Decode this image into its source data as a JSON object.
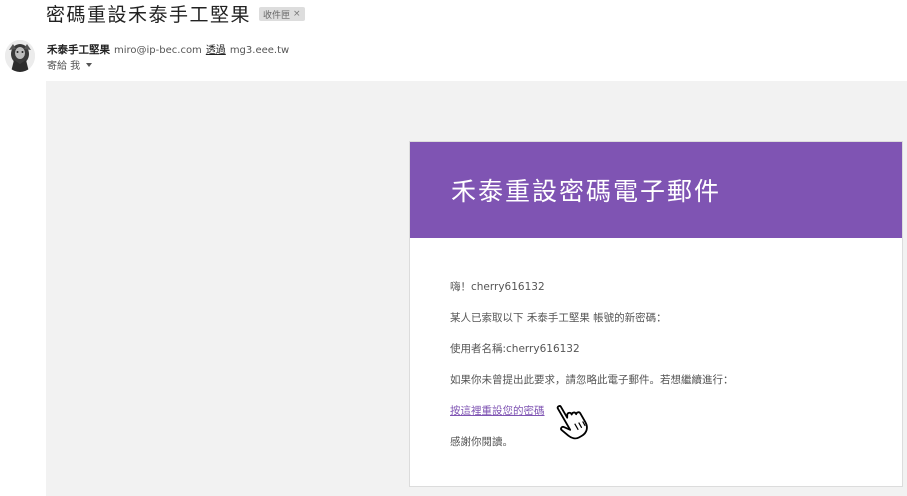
{
  "email": {
    "subject": "密碼重設禾泰手工堅果",
    "label_chip": "收件匣",
    "label_close": "×",
    "sender_name": "禾泰手工堅果",
    "sender_email": "miro@ip-bec.com",
    "via_label": "透過",
    "via_domain": "mg3.eee.tw",
    "to_label": "寄給 我"
  },
  "card": {
    "header_title": "禾泰重設密碼電子郵件",
    "greeting": "嗨！cherry616132",
    "line1": "某人已索取以下 禾泰手工堅果 帳號的新密碼：",
    "line2": "使用者名稱:cherry616132",
    "line3": "如果你未曾提出此要求，請忽略此電子郵件。若想繼續進行：",
    "reset_link": "按這裡重設您的密碼",
    "thanks": "感謝你閱讀。"
  },
  "colors": {
    "header_bg": "#7f54b3",
    "link": "#7f54b3",
    "body_bg": "#f2f2f2"
  },
  "icons": {
    "avatar": "avatar-portrait",
    "dropdown": "chevron-down-icon",
    "cursor": "hand-pointer-icon"
  }
}
